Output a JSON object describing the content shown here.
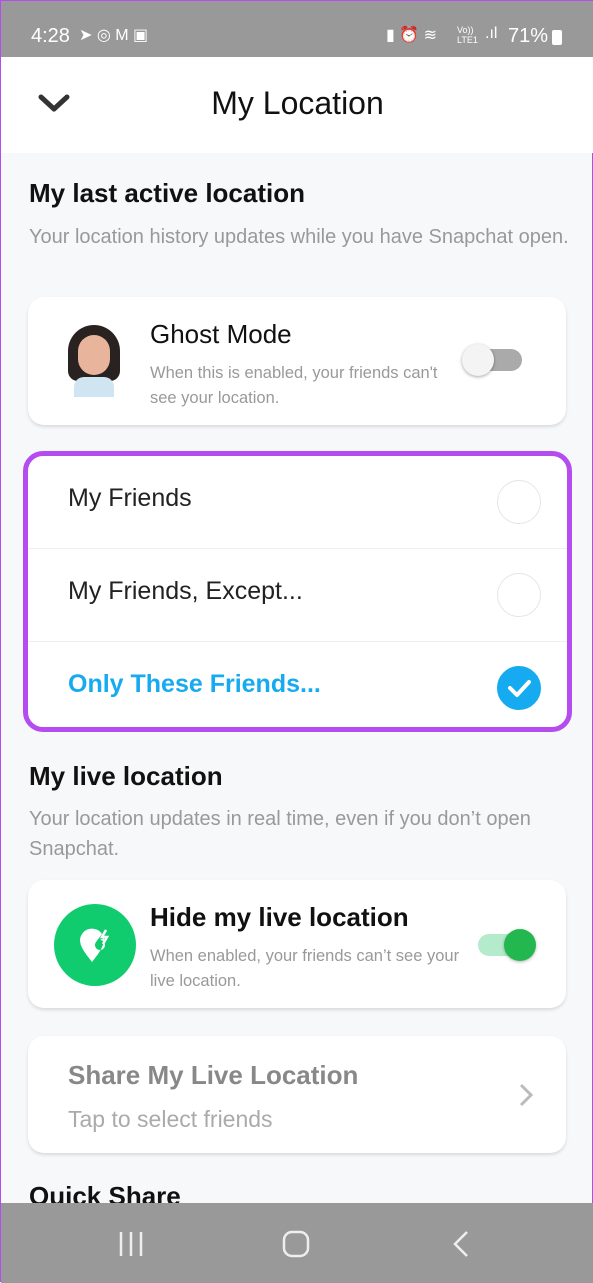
{
  "status_bar": {
    "time": "4:28",
    "battery": "71%",
    "network": "Vo)) LTE1"
  },
  "header": {
    "title": "My Location"
  },
  "last_active": {
    "title": "My last active location",
    "description": "Your location history updates while you have Snapchat open.",
    "ghost_mode": {
      "title": "Ghost Mode",
      "description": "When this is enabled, your friends can't see your location.",
      "enabled": false
    },
    "options": [
      {
        "label": "My Friends",
        "selected": false
      },
      {
        "label": "My Friends, Except...",
        "selected": false
      },
      {
        "label": "Only These Friends...",
        "selected": true
      }
    ]
  },
  "live": {
    "title": "My live location",
    "description": "Your location updates in real time, even if you don’t open Snapchat.",
    "hide": {
      "title": "Hide my live location",
      "description": "When enabled, your friends can’t see your live location.",
      "enabled": true
    },
    "share": {
      "title": "Share My Live Location",
      "subtitle": "Tap to select friends"
    }
  },
  "quick_share": {
    "title": "Quick Share"
  },
  "colors": {
    "accent_blue": "#16aaf0",
    "highlight_purple": "#b44cf0",
    "green": "#10cc6e"
  }
}
